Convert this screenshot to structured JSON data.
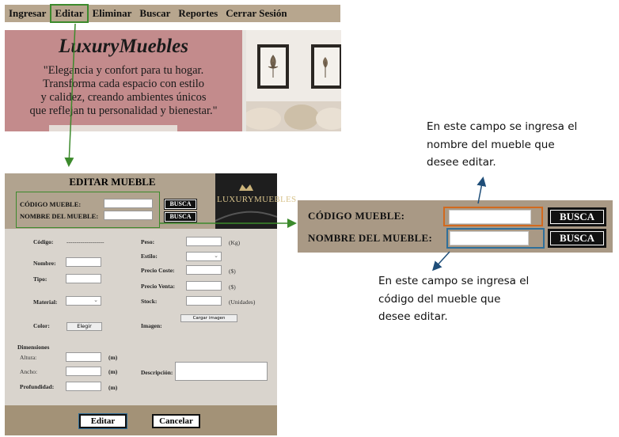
{
  "nav": {
    "items": [
      "Ingresar",
      "Editar",
      "Eliminar",
      "Buscar",
      "Reportes",
      "Cerrar Sesión"
    ]
  },
  "hero": {
    "title": "LuxuryMuebles",
    "quote_lines": [
      "\"Elegancia y confort para tu hogar.",
      "Transforma cada espacio con estilo",
      "y calidez, creando ambientes únicos",
      "que reflejan tu personalidad y bienestar.\""
    ]
  },
  "form": {
    "title": "EDITAR MUEBLE",
    "codigo_label": "CÓDIGO MUEBLE:",
    "nombre_label": "NOMBRE DEL MUEBLE:",
    "busca_label": "BUSCA",
    "logo_text": "LUXURYMUEBLES",
    "codigo": "Código:",
    "codigo_value": "-------------------",
    "nombre": "Nombre:",
    "tipo": "Tipo:",
    "material": "Material:",
    "color": "Color:",
    "elegir": "Elegir",
    "dimensiones": "Dimensiones",
    "altura": "Altura:",
    "ancho": "Ancho:",
    "profundidad": "Profundidad:",
    "unit_m": "(m)",
    "peso": "Peso:",
    "unit_kg": "(Kg)",
    "estilo": "Estilo:",
    "precio_coste": "Precio Coste:",
    "precio_venta": "Precio Venta:",
    "unit_dollar": "($)",
    "stock": "Stock:",
    "unit_unidades": "(Unidades)",
    "cargar_imagen": "Cargar imagen",
    "imagen": "Imagen:",
    "descripcion": "Descripción:",
    "editar_btn": "Editar",
    "cancelar_btn": "Cancelar"
  },
  "zoom": {
    "codigo_label": "CÓDIGO MUEBLE:",
    "nombre_label": "NOMBRE DEL MUEBLE:",
    "busca_label": "BUSCA"
  },
  "annotations": {
    "top": [
      "En este campo se ingresa el",
      "nombre del mueble que",
      "desee editar."
    ],
    "bottom": [
      "En este campo se ingresa el",
      "código del mueble que",
      "desee editar."
    ]
  },
  "colors": {
    "green_highlight": "#3c8a2c",
    "orange_highlight": "#d2691e",
    "blue_highlight": "#2f6f9a",
    "arrow": "#1f4e79",
    "hero_pink": "#c38b8c",
    "nav_tan": "#b7a68e"
  }
}
